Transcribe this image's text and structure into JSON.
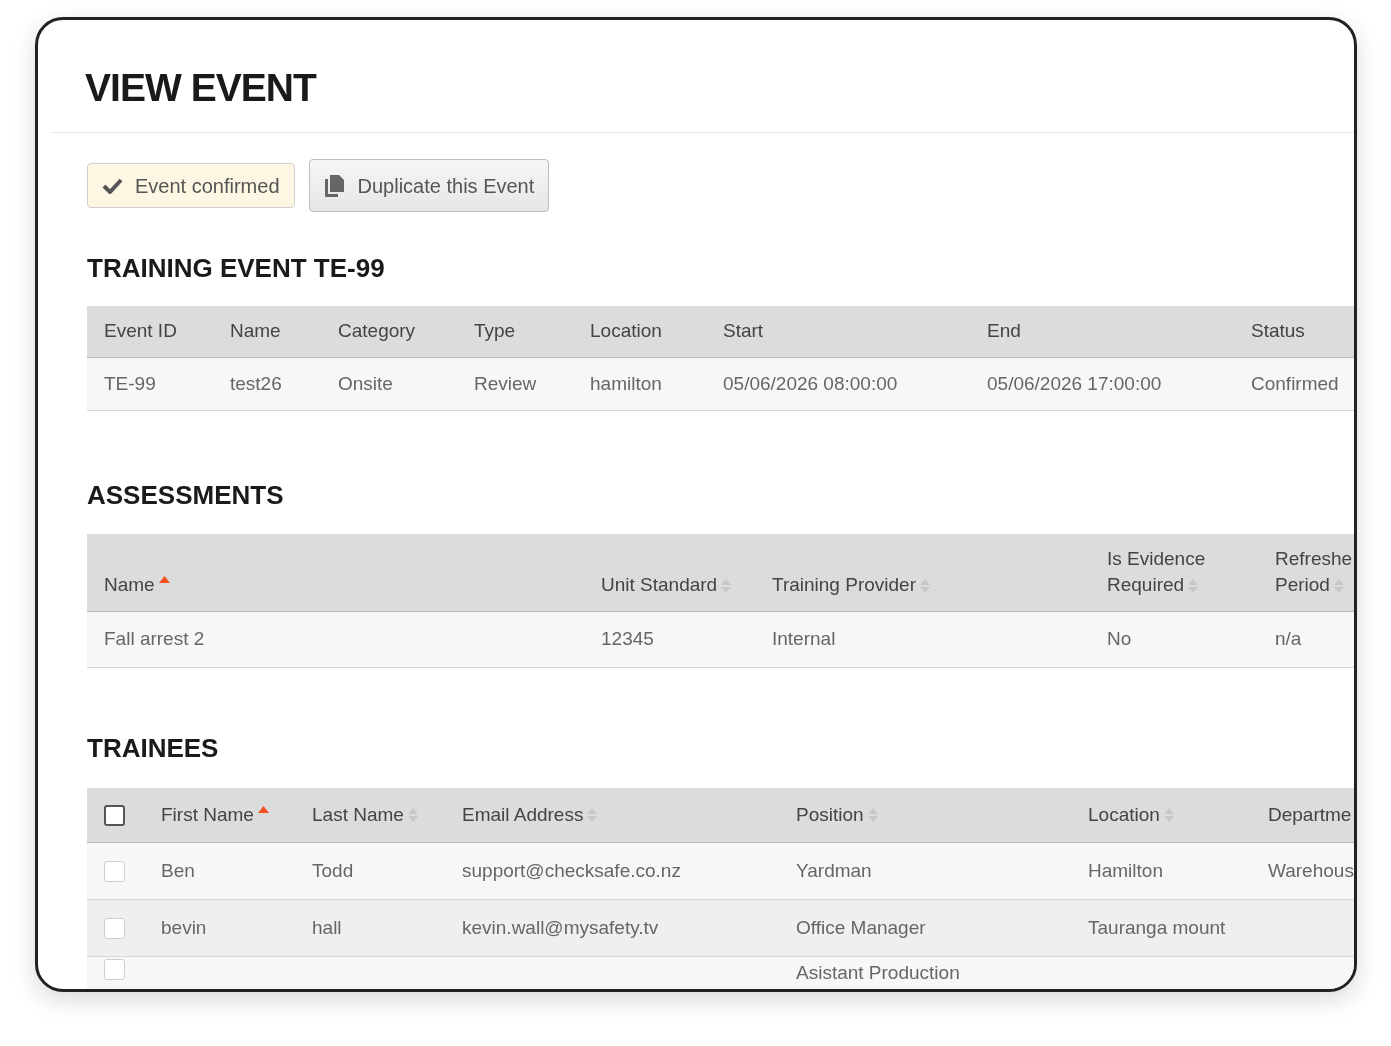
{
  "page_title": "VIEW EVENT",
  "actions": [
    {
      "kind": "status",
      "label": "Event confirmed"
    },
    {
      "kind": "button",
      "label": "Duplicate this Event"
    }
  ],
  "event": {
    "title": "TRAINING EVENT TE-99",
    "columns": [
      "Event ID",
      "Name",
      "Category",
      "Type",
      "Location",
      "Start",
      "End",
      "Status"
    ],
    "rows": [
      [
        "TE-99",
        "test26",
        "Onsite",
        "Review",
        "hamilton",
        "05/06/2026 08:00:00",
        "05/06/2026 17:00:00",
        "Confirmed"
      ]
    ]
  },
  "assessments": {
    "title": "ASSESSMENTS",
    "columns": [
      {
        "label": "Name",
        "sorted": true
      },
      {
        "label": "Unit Standard",
        "sorted": false
      },
      {
        "label": "Training Provider",
        "sorted": false
      },
      {
        "label": "Is Evidence Required",
        "sorted": false
      },
      {
        "label": "Refreshe Period",
        "sorted": false
      }
    ],
    "rows": [
      [
        "Fall arrest 2",
        "12345",
        "Internal",
        "No",
        "n/a"
      ]
    ]
  },
  "trainees": {
    "title": "TRAINEES",
    "select_all": {
      "checked": false
    },
    "columns": [
      {
        "label": "First Name",
        "sorted": true
      },
      {
        "label": "Last Name",
        "sorted": false
      },
      {
        "label": "Email Address",
        "sorted": false
      },
      {
        "label": "Position",
        "sorted": false
      },
      {
        "label": "Location",
        "sorted": false
      },
      {
        "label": "Departme"
      }
    ],
    "rows": [
      {
        "checked": false,
        "cells": [
          "Ben",
          "Todd",
          "support@checksafe.co.nz",
          "Yardman",
          "Hamilton",
          "Warehous"
        ]
      },
      {
        "checked": false,
        "cells": [
          "bevin",
          "hall",
          "kevin.wall@mysafety.tv",
          "Office Manager",
          "Tauranga mount",
          ""
        ]
      },
      {
        "checked": false,
        "cells": [
          "",
          "",
          "",
          "Asistant Production",
          "",
          ""
        ]
      }
    ]
  }
}
